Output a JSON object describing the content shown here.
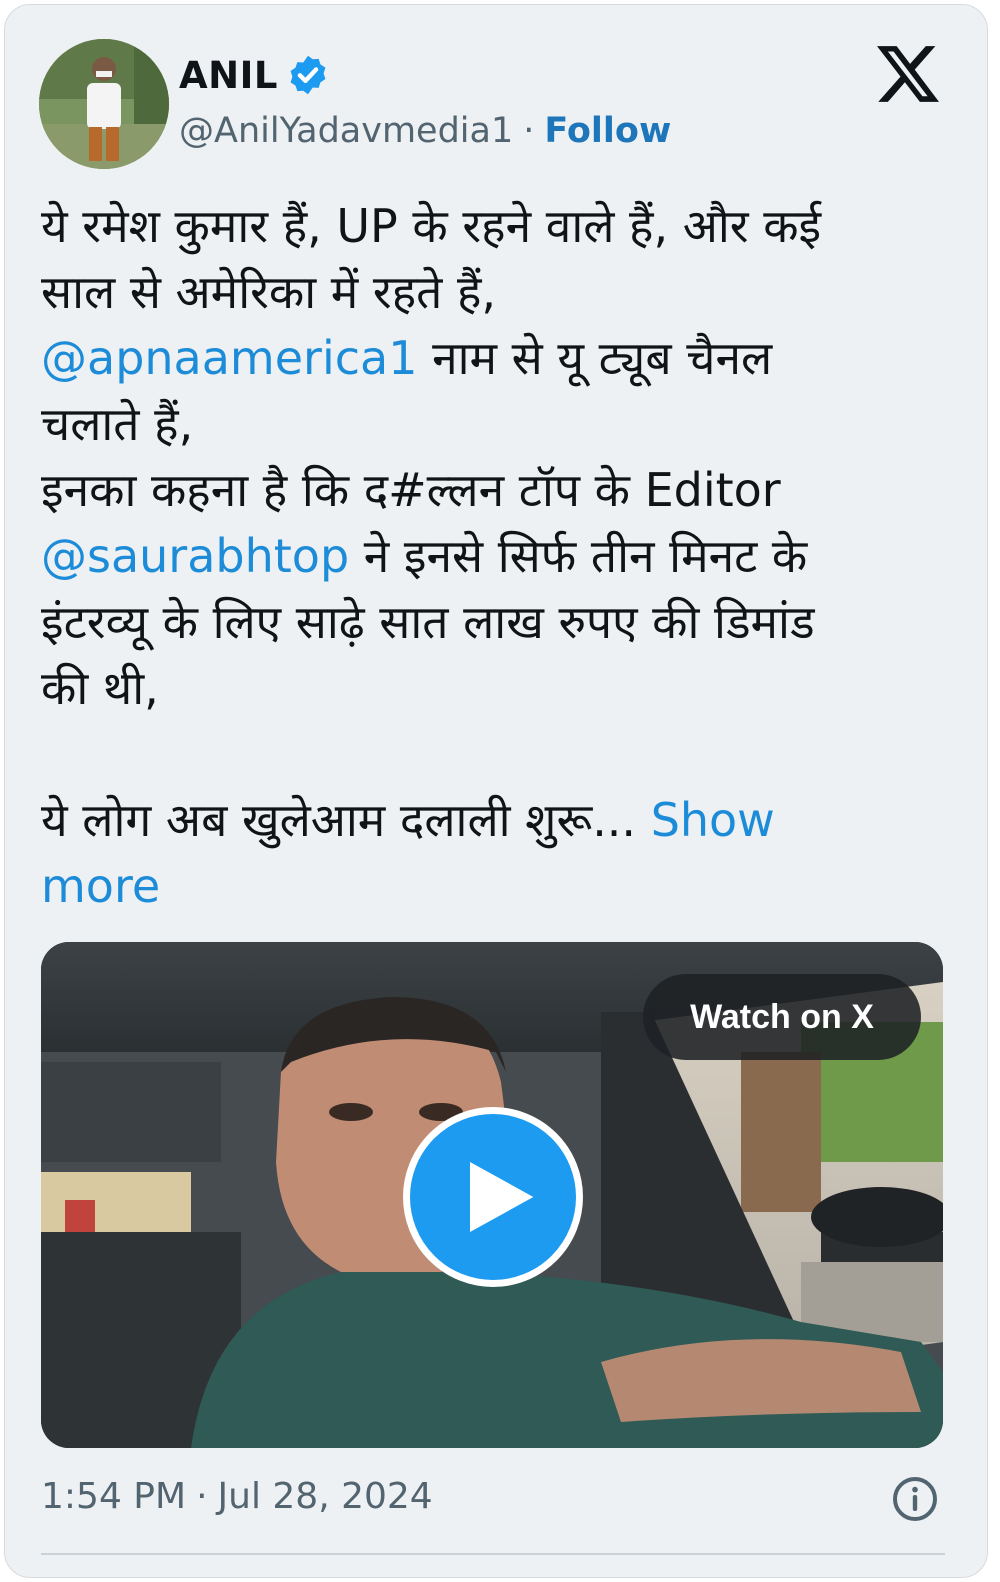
{
  "author": {
    "name": "ANIL",
    "handle": "@AnilYadavmedia1",
    "separator": "·",
    "follow_label": "Follow",
    "verified": true,
    "avatar_icon": "profile-photo"
  },
  "platform_icon": "x-logo-icon",
  "tweet": {
    "line1": "ये रमेश कुमार हैं, UP के रहने वाले हैं, और कई",
    "line2": "साल  से अमेरिका में रहते हैं,",
    "line3_mention": "@apnaamerica1",
    "line3_text": "  नाम से यू ट्यूब चैनल",
    "line4": "चलाते हैं,",
    "line5": "इनका कहना है कि द#ल्लन टॉप के Editor",
    "line6_mention": "@saurabhtop",
    "line6_text": " ने इनसे सिर्फ तीन मिनट के",
    "line7": "इंटरव्यू के लिए साढ़े सात लाख रुपए की डिमांड",
    "line8": "की थी,",
    "line9": "ये लोग अब खुलेआम दलाली शुरू... ",
    "show_more_part1": "Show",
    "show_more_part2": "more"
  },
  "media": {
    "watch_label": "Watch on X",
    "play_icon": "play-icon"
  },
  "footer": {
    "time": "1:54 PM",
    "separator": "·",
    "date": "Jul 28, 2024",
    "info_icon": "info-icon"
  },
  "colors": {
    "link": "#1d8cd8",
    "follow": "#1d76b9",
    "play_button": "#1d9bf0",
    "card_bg": "#eef1f3"
  }
}
